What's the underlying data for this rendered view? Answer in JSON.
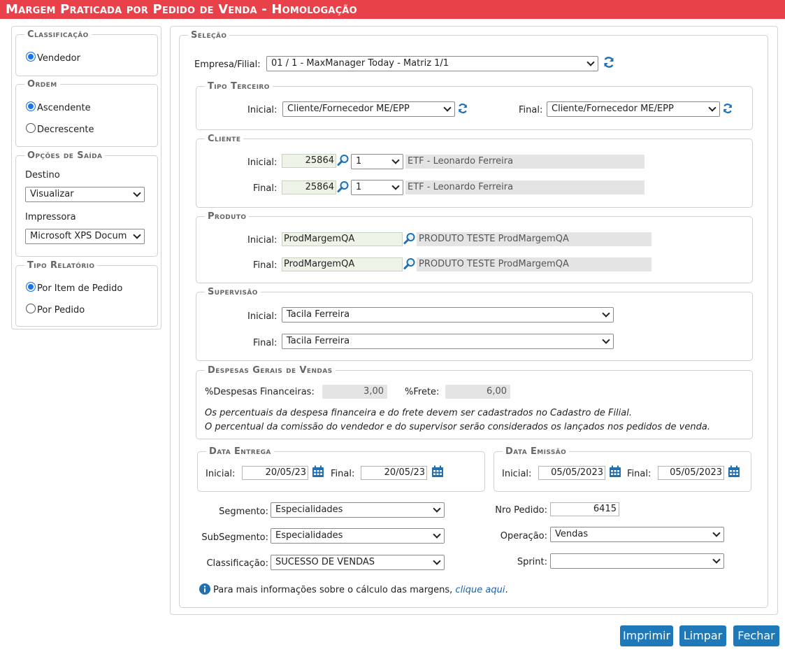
{
  "title": "Margem Praticada por Pedido de Venda  - Homologação",
  "classificacao": {
    "legend": "Classificação",
    "option": "Vendedor"
  },
  "ordem": {
    "legend": "Ordem",
    "options": [
      "Ascendente",
      "Decrescente"
    ],
    "selected": "Ascendente"
  },
  "opcoes_saida": {
    "legend": "Opções de Saída",
    "destino_label": "Destino",
    "destino_value": "Visualizar",
    "impressora_label": "Impressora",
    "impressora_value": "Microsoft XPS Docum"
  },
  "tipo_relatorio": {
    "legend": "Tipo Relatório",
    "options": [
      "Por Item de Pedido",
      "Por Pedido"
    ],
    "selected": "Por Item de Pedido"
  },
  "selecao": {
    "legend": "Seleção",
    "empresa_label": "Empresa/Filial:",
    "empresa_value": "01 / 1 - MaxManager Today - Matriz 1/1"
  },
  "tipo_terceiro": {
    "legend": "Tipo Terceiro",
    "inicial_label": "Inicial:",
    "inicial_value": "Cliente/Fornecedor ME/EPP",
    "final_label": "Final:",
    "final_value": "Cliente/Fornecedor ME/EPP"
  },
  "cliente": {
    "legend": "Cliente",
    "inicial_label": "Inicial:",
    "inicial_code": "25864",
    "inicial_seq": "1",
    "inicial_name": "ETF - Leonardo Ferreira",
    "final_label": "Final:",
    "final_code": "25864",
    "final_seq": "1",
    "final_name": "ETF - Leonardo Ferreira"
  },
  "produto": {
    "legend": "Produto",
    "inicial_label": "Inicial:",
    "inicial_code": "ProdMargemQA",
    "inicial_desc": "PRODUTO TESTE ProdMargemQA",
    "final_label": "Final:",
    "final_code": "ProdMargemQA",
    "final_desc": "PRODUTO TESTE ProdMargemQA"
  },
  "supervisao": {
    "legend": "Supervisão",
    "inicial_label": "Inicial:",
    "inicial_value": "Tacila Ferreira",
    "final_label": "Final:",
    "final_value": "Tacila Ferreira"
  },
  "despesas": {
    "legend": "Despesas Gerais de Vendas",
    "fin_label": "%Despesas Financeiras:",
    "fin_value": "3,00",
    "frete_label": "%Frete:",
    "frete_value": "6,00",
    "note1": "Os percentuais da despesa financeira e do frete devem ser cadastrados no Cadastro de Filial.",
    "note2": "O percentual da comissão do vendedor e do supervisor serão considerados os lançados nos pedidos de venda."
  },
  "data_entrega": {
    "legend": "Data Entrega",
    "inicial_label": "Inicial:",
    "inicial_value": "20/05/23",
    "final_label": "Final:",
    "final_value": "20/05/23"
  },
  "data_emissao": {
    "legend": "Data Emissão",
    "inicial_label": "Inicial:",
    "inicial_value": "05/05/2023",
    "final_label": "Final:",
    "final_value": "05/05/2023"
  },
  "filtros": {
    "segmento_label": "Segmento:",
    "segmento_value": "Especialidades",
    "subsegmento_label": "SubSegmento:",
    "subsegmento_value": "Especialidades",
    "classificacao_label": "Classificação:",
    "classificacao_value": "SUCESSO DE VENDAS",
    "nro_pedido_label": "Nro Pedido:",
    "nro_pedido_value": "6415",
    "operacao_label": "Operação:",
    "operacao_value": "Vendas",
    "sprint_label": "Sprint:",
    "sprint_value": ""
  },
  "info": {
    "text": "Para mais informações sobre o cálculo das margens,",
    "link": "clique aqui",
    "suffix": "."
  },
  "buttons": {
    "imprimir": "Imprimir",
    "limpar": "Limpar",
    "fechar": "Fechar"
  },
  "colors": {
    "title_bar": "#e8414a",
    "button": "#1f78b8",
    "icon": "#1f6fb2"
  }
}
